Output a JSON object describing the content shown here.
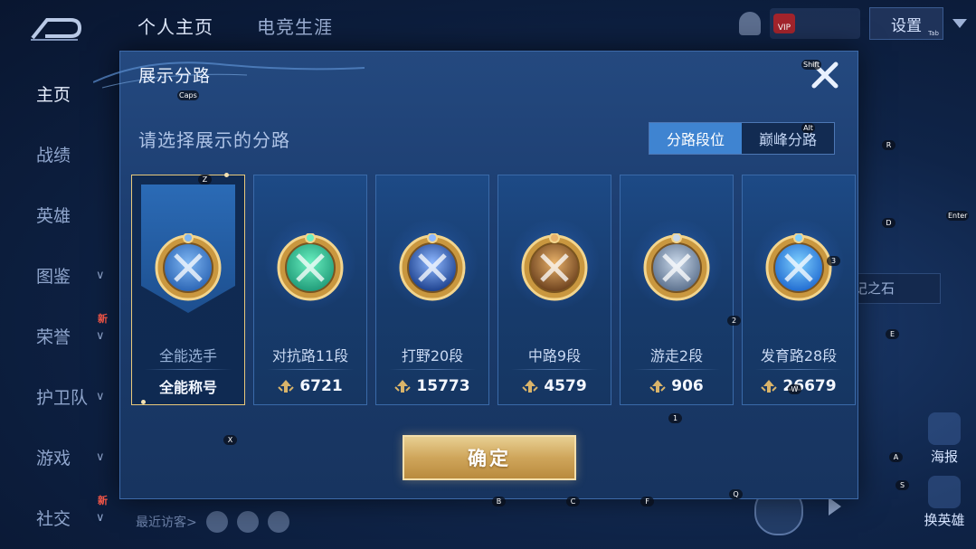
{
  "top_tabs": [
    "个人主页",
    "电竞生涯"
  ],
  "settings_label": "设置",
  "settings_key_hint": "Tab",
  "vip_label": "VIP",
  "sidebar": [
    {
      "label": "主页",
      "active": true,
      "chevron": false,
      "new": false
    },
    {
      "label": "战绩",
      "active": false,
      "chevron": false,
      "new": false
    },
    {
      "label": "英雄",
      "active": false,
      "chevron": false,
      "new": false
    },
    {
      "label": "图鉴",
      "active": false,
      "chevron": true,
      "new": false
    },
    {
      "label": "荣誉",
      "active": false,
      "chevron": true,
      "new": true
    },
    {
      "label": "护卫队",
      "active": false,
      "chevron": true,
      "new": false
    },
    {
      "label": "游戏",
      "active": false,
      "chevron": true,
      "new": false
    },
    {
      "label": "社交",
      "active": false,
      "chevron": true,
      "new": true
    }
  ],
  "new_badge": "新",
  "recent_visitors": "最近访客>",
  "stone_label": "铭记之石",
  "poster_button": "海报",
  "swap_hero_button": "换英雄",
  "modal": {
    "title": "展示分路",
    "subtitle": "请选择展示的分路",
    "toggle": [
      "分路段位",
      "巅峰分路"
    ],
    "toggle_active": 0,
    "confirm_label": "确定",
    "cards": [
      {
        "name": "全能选手",
        "value": "全能称号",
        "selected": true,
        "emblem": "allround-emblem-icon",
        "colors": [
          "#7fb6f2",
          "#2a64b4"
        ]
      },
      {
        "name": "对抗路11段",
        "value": "6721",
        "selected": false,
        "emblem": "clash-lane-emblem-icon",
        "colors": [
          "#6af0c0",
          "#1f9a78"
        ]
      },
      {
        "name": "打野20段",
        "value": "15773",
        "selected": false,
        "emblem": "jungle-emblem-icon",
        "colors": [
          "#8fb8ff",
          "#1b3f8c"
        ]
      },
      {
        "name": "中路9段",
        "value": "4579",
        "selected": false,
        "emblem": "mid-lane-emblem-icon",
        "colors": [
          "#e9b26a",
          "#6a3f1c"
        ]
      },
      {
        "name": "游走2段",
        "value": "906",
        "selected": false,
        "emblem": "roam-emblem-icon",
        "colors": [
          "#c9d8ea",
          "#5a6f8c"
        ]
      },
      {
        "name": "发育路28段",
        "value": "26679",
        "selected": false,
        "emblem": "farm-lane-emblem-icon",
        "colors": [
          "#7fd0ff",
          "#1f6ad0"
        ]
      }
    ]
  },
  "key_hints": {
    "caps": "Caps",
    "shift": "Shift",
    "alt": "Alt",
    "z": "Z",
    "x": "X",
    "r": "R",
    "d": "D",
    "e": "E",
    "three": "3",
    "two": "2",
    "one": "1",
    "w": "W",
    "a": "A",
    "s": "S",
    "b": "B",
    "c": "C",
    "f": "F",
    "q": "Q",
    "enter": "Enter"
  }
}
